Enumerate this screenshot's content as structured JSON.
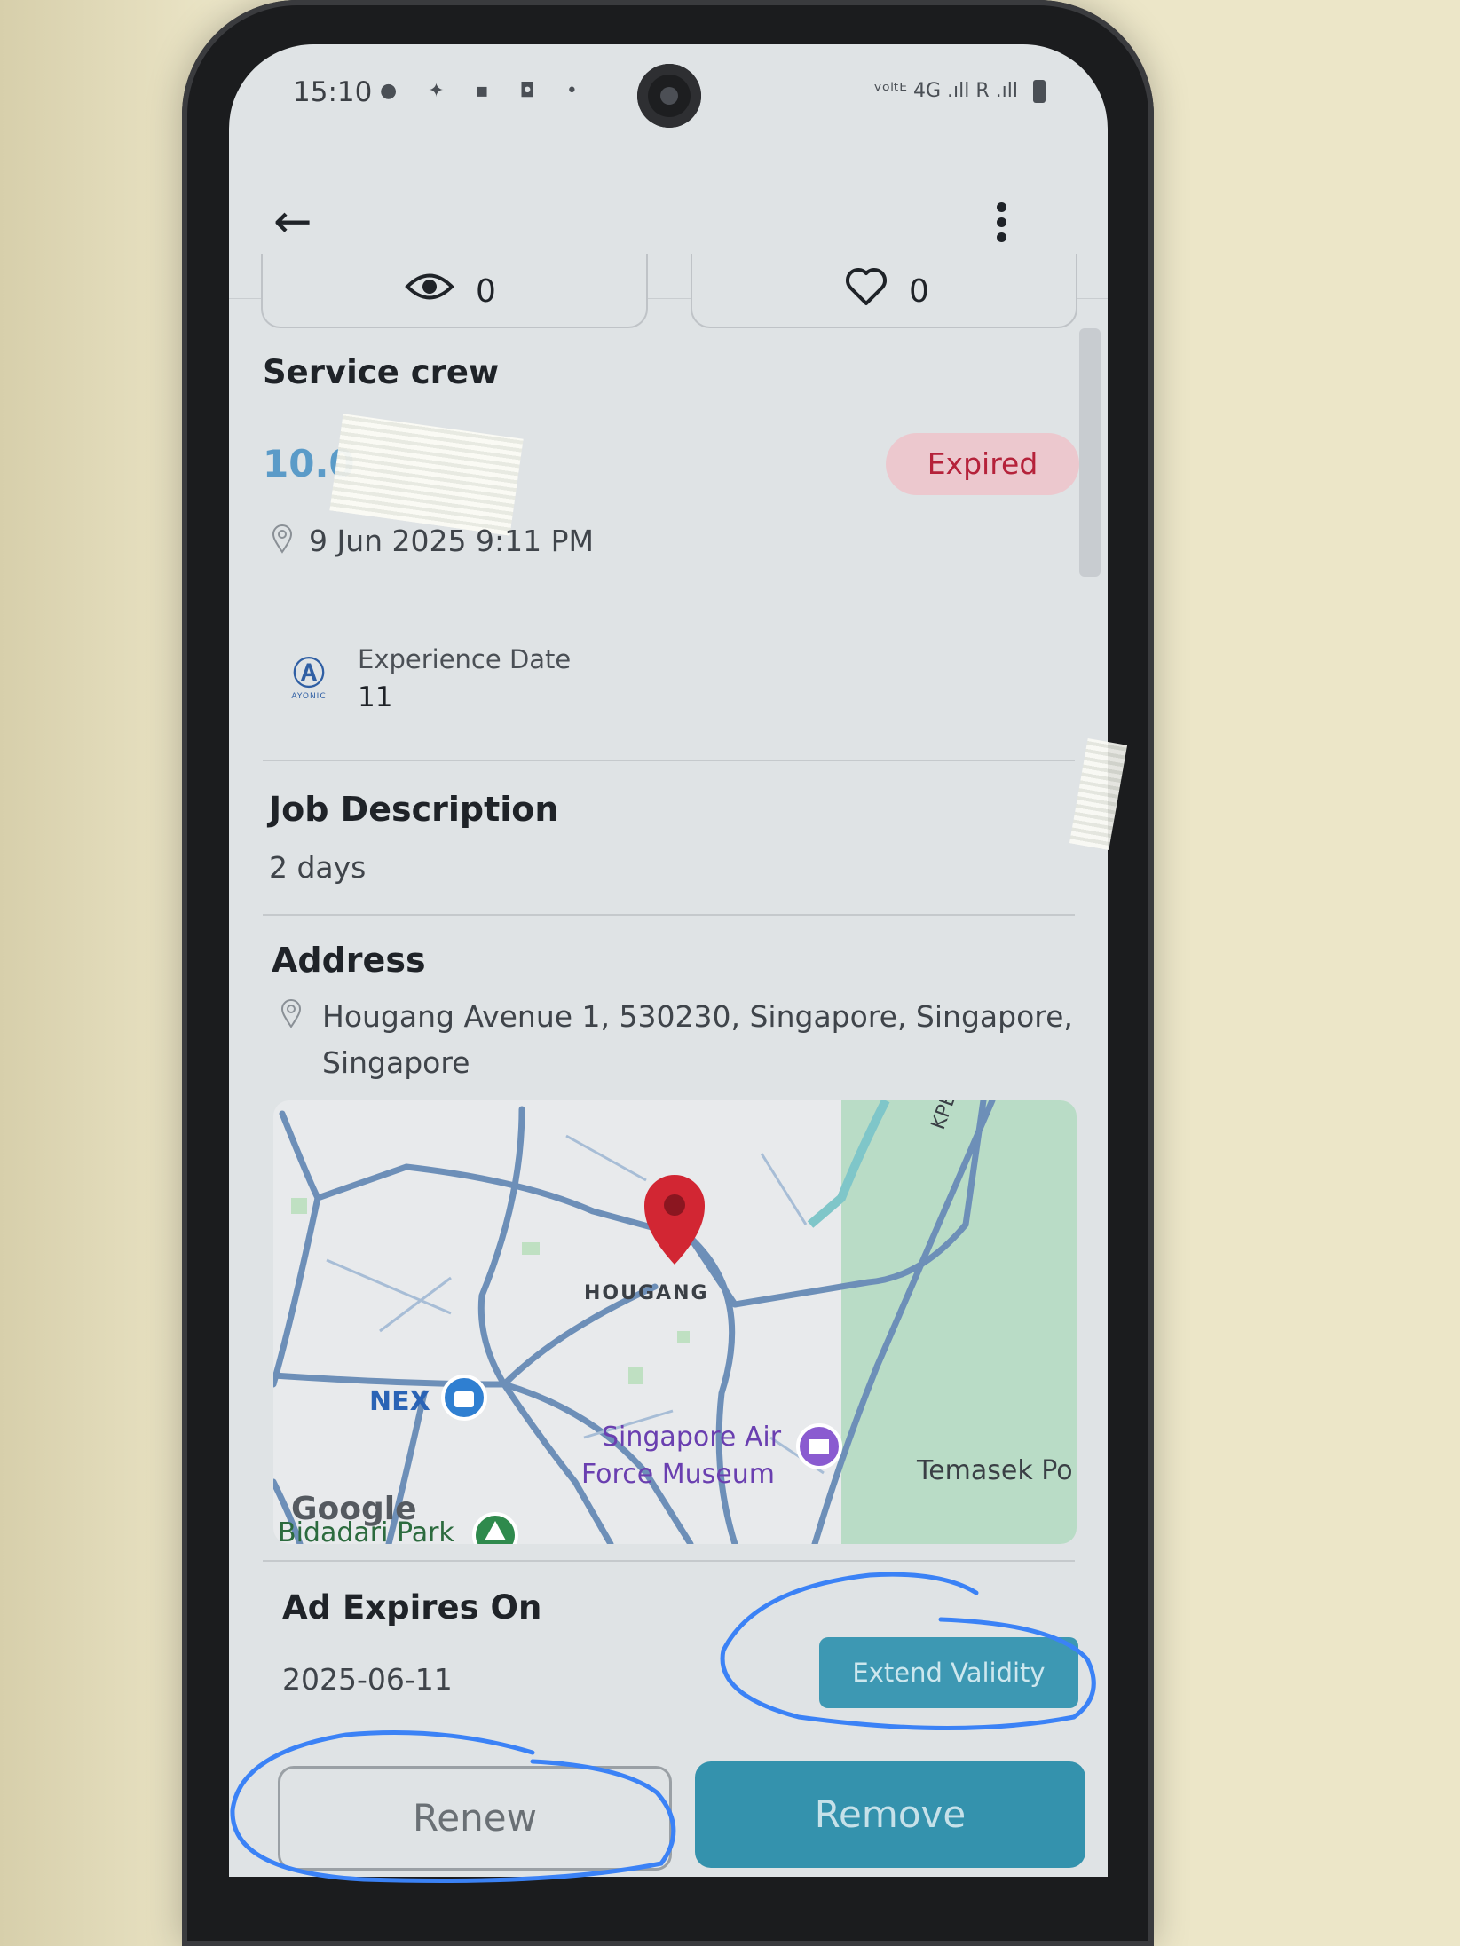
{
  "status_bar": {
    "time": "15:10",
    "left_icons": "● ✦ ▪ ◘ •",
    "network": "ᵛᵒˡᵗᴱ 4G .ıll R .ıll"
  },
  "stats": {
    "views": "0",
    "likes": "0"
  },
  "job": {
    "title": "Service crew",
    "salary": "10.0",
    "status": "Expired",
    "posted_date": "9 Jun 2025 9:11 PM",
    "experience_label": "Experience Date",
    "experience_value": "11",
    "company_logo_text": "AYONIC"
  },
  "description": {
    "heading": "Job Description",
    "text": "2 days"
  },
  "address": {
    "heading": "Address",
    "text": "Hougang Avenue 1, 530230, Singapore, Singapore, Singapore"
  },
  "map": {
    "labels": {
      "hougang": "HOUGANG",
      "nex": "NEX",
      "museum_line1": "Singapore Air",
      "museum_line2": "Force Museum",
      "temasek": "Temasek Po",
      "park": "Bidadari Park",
      "google": "Google",
      "road": "KPE"
    }
  },
  "expiry": {
    "heading": "Ad Expires On",
    "date": "2025-06-11",
    "extend_label": "Extend Validity"
  },
  "actions": {
    "renew_label": "Renew",
    "remove_label": "Remove"
  },
  "colors": {
    "accent": "#3492ad",
    "salary": "#5b9bc8",
    "expired_bg": "#ecc8ce",
    "expired_text": "#b5223a",
    "annotation": "#3b82f6"
  }
}
